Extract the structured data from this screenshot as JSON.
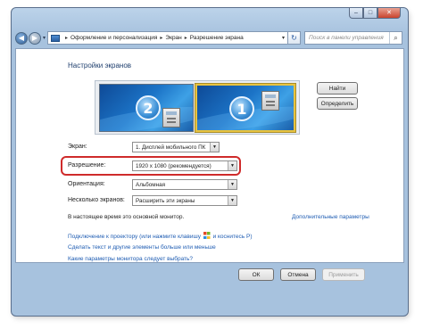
{
  "window": {
    "caption": {
      "minimize": "–",
      "maximize": "□",
      "close": "✕"
    }
  },
  "nav": {
    "back": "◀",
    "forward": "▶",
    "dropdown": "▾",
    "breadcrumbs": [
      "Оформление и персонализация",
      "Экран",
      "Разрешение экрана"
    ],
    "separator": "▸",
    "address_dropdown": "▾",
    "refresh": "↻",
    "search_placeholder": "Поиск в панели управления",
    "search_icon": "⌕"
  },
  "main": {
    "heading": "Настройки экранов",
    "monitors": [
      {
        "number": "2",
        "selected": false
      },
      {
        "number": "1",
        "selected": true
      }
    ],
    "find_button": "Найти",
    "identify_button": "Определить",
    "fields": {
      "display": {
        "label": "Экран:",
        "value": "1. Дисплей мобильного ПК"
      },
      "resolution": {
        "label": "Разрешение:",
        "value": "1920 x 1080 (рекомендуется)"
      },
      "orientation": {
        "label": "Ориентация:",
        "value": "Альбомная"
      },
      "multiple": {
        "label": "Несколько экранов:",
        "value": "Расширить эти экраны"
      }
    },
    "dropdown_arrow": "▼",
    "primary_note": "В настоящее время это основной монитор.",
    "advanced_link": "Дополнительные параметры",
    "projector_link_pre": "Подключение к проектору (или нажмите клавишу",
    "projector_link_post": "и коснитесь P)",
    "text_size_link": "Сделать текст и другие элементы больше или меньше",
    "help_link": "Какие параметры монитора следует выбрать?"
  },
  "footer": {
    "ok": "ОК",
    "cancel": "Отмена",
    "apply": "Применить"
  },
  "colors": {
    "highlight": "#cf2b2b",
    "link": "#1f5db3",
    "heading": "#1f3f6e"
  }
}
